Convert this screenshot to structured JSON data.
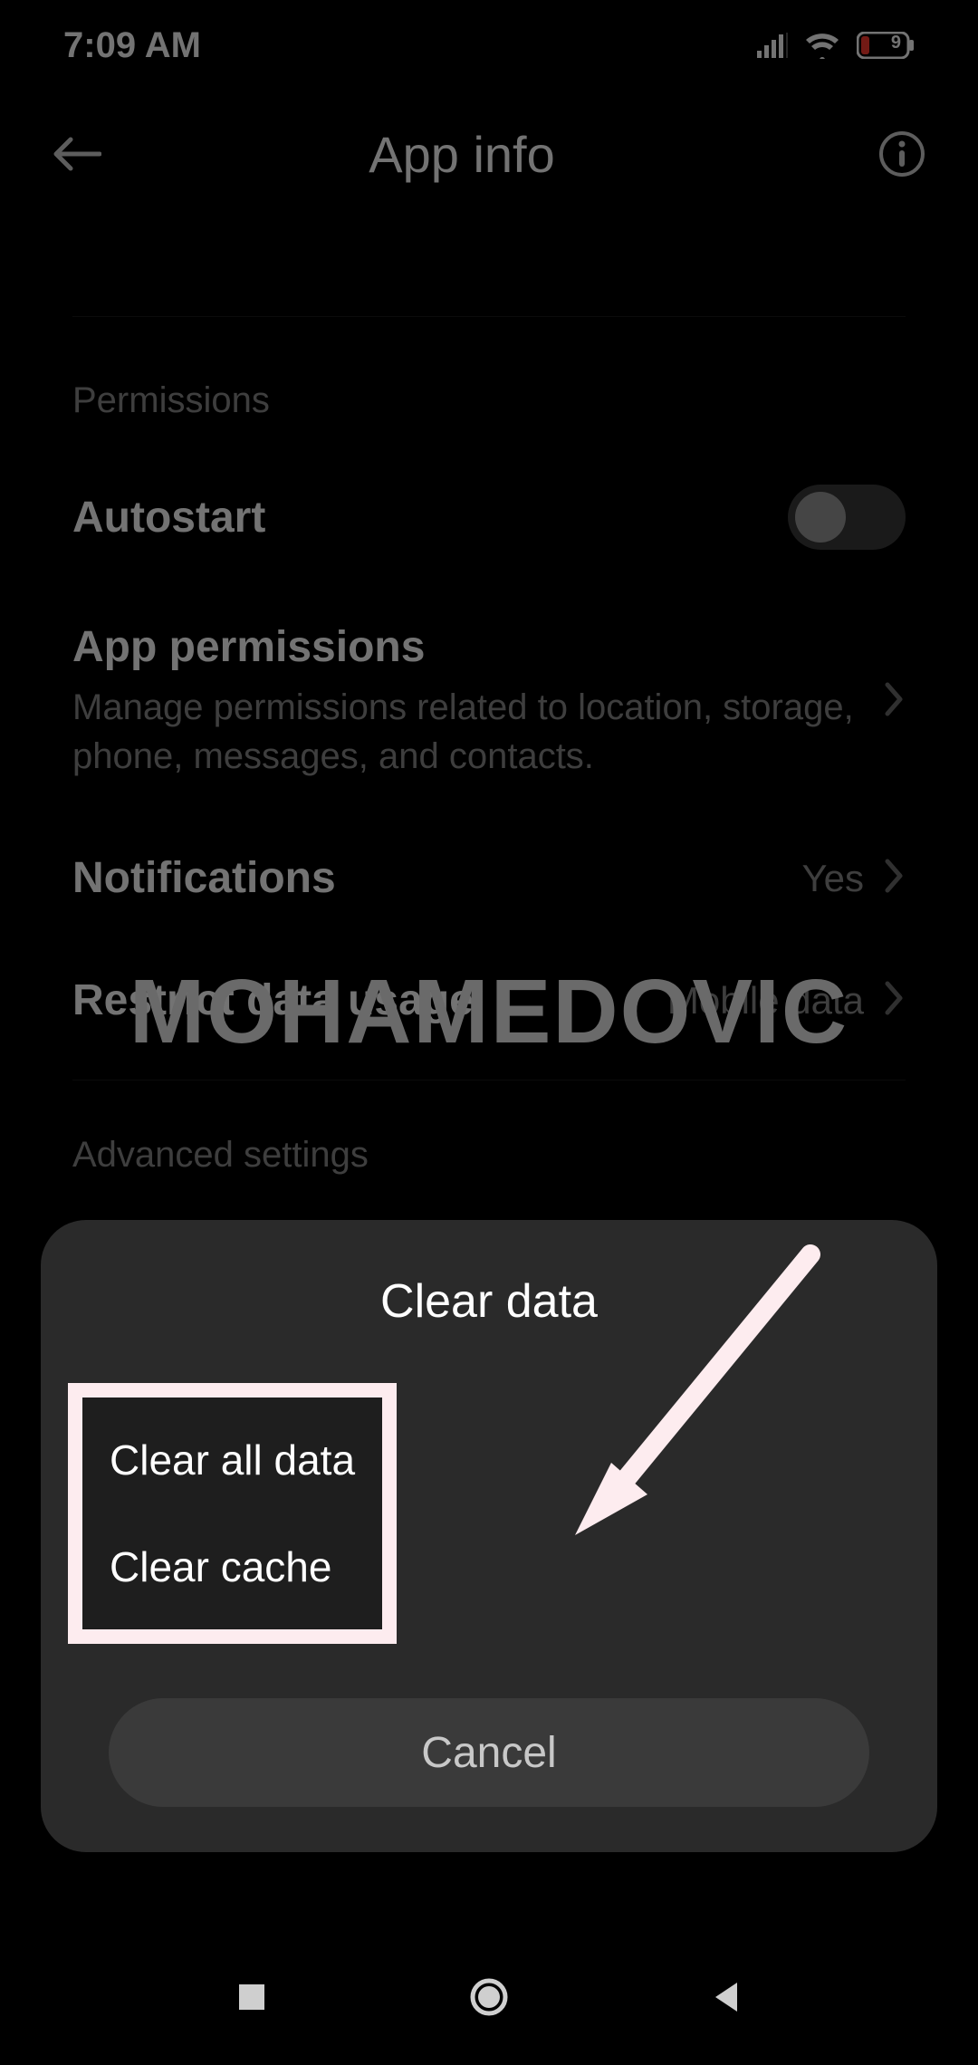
{
  "statusbar": {
    "time": "7:09 AM",
    "battery_level": "9"
  },
  "header": {
    "title": "App info"
  },
  "sections": {
    "permissions_label": "Permissions",
    "autostart": {
      "label": "Autostart"
    },
    "app_permissions": {
      "label": "App permissions",
      "subtitle": "Manage permissions related to location, storage, phone, messages, and contacts."
    },
    "notifications": {
      "label": "Notifications",
      "value": "Yes"
    },
    "restrict_data": {
      "label": "Restrict data usage",
      "value": "Mobile data"
    },
    "advanced_label": "Advanced settings"
  },
  "watermark": "MOHAMEDOVIC",
  "dialog": {
    "title": "Clear data",
    "option1": "Clear all data",
    "option2": "Clear cache",
    "cancel": "Cancel"
  }
}
